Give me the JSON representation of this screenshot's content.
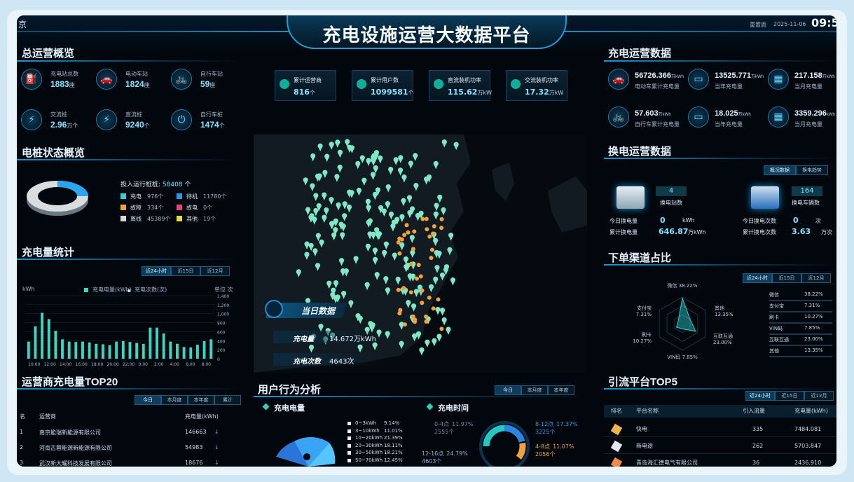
{
  "header": {
    "title": "充电设施运营大数据平台",
    "left_fragment": "京",
    "right_label": "重置面",
    "date": "2025-11-06",
    "clock": "09:5"
  },
  "overview": {
    "title": "总运营概览",
    "items": [
      {
        "label": "充电站总数",
        "value": "1883",
        "unit": "座",
        "icon": "charging-station-icon"
      },
      {
        "label": "电动车站",
        "value": "1824",
        "unit": "座",
        "icon": "electric-car-icon"
      },
      {
        "label": "自行车站",
        "value": "59",
        "unit": "座",
        "icon": "bicycle-icon"
      },
      {
        "label": "交流桩",
        "value": "2.96",
        "unit": "万个",
        "icon": "ac-charger-icon"
      },
      {
        "label": "直流桩",
        "value": "9240",
        "unit": "个",
        "icon": "dc-charger-icon"
      },
      {
        "label": "自行车桩",
        "value": "1474",
        "unit": "个",
        "icon": "bike-charger-icon"
      }
    ]
  },
  "pile_status": {
    "title": "电桩状态概览",
    "running_label": "投入运行桩桩:",
    "running_value": "58408",
    "running_unit": "个",
    "legend": [
      {
        "label": "充电",
        "value": "976个",
        "color": "#2fd3d6"
      },
      {
        "label": "待机",
        "value": "11780个",
        "color": "#1f9cf0"
      },
      {
        "label": "故障",
        "value": "334个",
        "color": "#f2a23b"
      },
      {
        "label": "故电",
        "value": "0个",
        "color": "#e8447a"
      },
      {
        "label": "离线",
        "value": "45389个",
        "color": "#d5d9dc"
      },
      {
        "label": "其他",
        "value": "19个",
        "color": "#e3e043"
      }
    ]
  },
  "charge_stats": {
    "title": "充电量统计",
    "tabs": [
      "近24小时",
      "近15日",
      "近12月"
    ],
    "legend": [
      "充电电量(kWh)",
      "充电次数(次)"
    ],
    "left_unit": "kWh",
    "right_unit": "单位 次",
    "right_ticks": [
      "1,400",
      "1,200",
      "1,000",
      "800",
      "600",
      "400",
      "200",
      "0"
    ]
  },
  "operator_top": {
    "title": "运营商充电量TOP20",
    "tabs": [
      "今日",
      "本月度",
      "本年度",
      "累计"
    ],
    "headers": [
      "名",
      "运营商",
      "充电量(kWh)"
    ],
    "rows": [
      {
        "rank": "1",
        "name": "南京能瑞新能源有限公司",
        "value": "146663"
      },
      {
        "rank": "2",
        "name": "河南古蓉能源新能源有限公司",
        "value": "54983"
      },
      {
        "rank": "3",
        "name": "武汉新大耀科技发展有限公司",
        "value": "18676"
      }
    ]
  },
  "stats_top": [
    {
      "label": "累计运营商",
      "value": "816",
      "unit": "个"
    },
    {
      "label": "累计用户数",
      "value": "1099581",
      "unit": "个"
    },
    {
      "label": "直流装机功率",
      "value": "115.62",
      "unit": "万kW"
    },
    {
      "label": "交流装机功率",
      "value": "17.32",
      "unit": "万kW"
    }
  ],
  "map": {
    "today_label": "当日数据",
    "charge_label": "充电量",
    "charge_value": "14.672万kWh",
    "count_label": "充电次数",
    "count_value": "4643次"
  },
  "user_behavior": {
    "title": "用户行为分析",
    "tabs": [
      "今日",
      "本月度",
      "本年度"
    ],
    "energy_title": "充电电量",
    "time_title": "充电时间",
    "energy_legend": [
      {
        "label": "0~3kWh",
        "value": "9.14%"
      },
      {
        "label": "3~10kWh",
        "value": "11.01%"
      },
      {
        "label": "10~20kWh",
        "value": "21.39%"
      },
      {
        "label": "20~30kWh",
        "value": "18.11%"
      },
      {
        "label": "30~50kWh",
        "value": "18.21%"
      },
      {
        "label": "50~70kWh",
        "value": "12.45%"
      }
    ],
    "time_labels": [
      {
        "label": "0-4点",
        "value": "11.97%",
        "count": "2555个"
      },
      {
        "label": "8-12点",
        "value": "17.37%",
        "count": "3225个"
      },
      {
        "label": "4-8点",
        "value": "11.07%",
        "count": "2056个"
      },
      {
        "label": "12-16点",
        "value": "24.79%",
        "count": "4603个"
      }
    ]
  },
  "ops_data": {
    "title": "充电运营数据",
    "items": [
      {
        "value": "56726.366",
        "unit": "万kWh",
        "label": "电动车累计充电量"
      },
      {
        "value": "13525.771",
        "unit": "万kWh",
        "label": "当年充电量"
      },
      {
        "value": "217.158",
        "unit": "万kWh",
        "label": "当月充电量"
      },
      {
        "value": "57.603",
        "unit": "万kWh",
        "label": "自行车累计充电量"
      },
      {
        "value": "18.025",
        "unit": "万kWh",
        "label": "当年充电量"
      },
      {
        "value": "3359.296",
        "unit": "kWh",
        "label": "当月充电量"
      }
    ]
  },
  "swap": {
    "title": "换电运营数据",
    "tabs": [
      "概况数据",
      "换电趋势"
    ],
    "station_count": "4",
    "station_label": "换电站数",
    "vehicle_count": "164",
    "vehicle_label": "换电车辆数",
    "left_rows": [
      {
        "label": "今日换电量",
        "value": "0",
        "unit": "kWh"
      },
      {
        "label": "累计换电量",
        "value": "646.87",
        "unit": "万kWh"
      }
    ],
    "right_rows": [
      {
        "label": "今日换电次数",
        "value": "0",
        "unit": "次"
      },
      {
        "label": "累计换电次数",
        "value": "3.63",
        "unit": "万次"
      }
    ]
  },
  "channel": {
    "title": "下单渠道占比",
    "tabs": [
      "近24小时",
      "近15日",
      "近12月"
    ],
    "radar": [
      {
        "label": "微信",
        "value": "38.22%"
      },
      {
        "label": "其他",
        "value": "13.35%"
      },
      {
        "label": "互联互通",
        "value": "23.00%"
      },
      {
        "label": "VIN码",
        "value": "7.85%"
      },
      {
        "label": "刷卡",
        "value": "10.27%"
      },
      {
        "label": "支付宝",
        "value": "7.31%"
      }
    ],
    "list": [
      {
        "label": "微信",
        "value": "38.22%"
      },
      {
        "label": "支付宝",
        "value": "7.31%"
      },
      {
        "label": "刷卡",
        "value": "10.27%"
      },
      {
        "label": "VIN码",
        "value": "7.85%"
      },
      {
        "label": "互联互通",
        "value": "23.00%"
      },
      {
        "label": "其他",
        "value": "13.35%"
      }
    ]
  },
  "traffic": {
    "title": "引流平台TOP5",
    "tabs": [
      "近24小时",
      "近15日",
      "近12月"
    ],
    "headers": [
      "排名",
      "平台名称",
      "引入流量",
      "充电量(kWh)"
    ],
    "rows": [
      {
        "name": "快电",
        "flow": "335",
        "energy": "7484.081"
      },
      {
        "name": "新电途",
        "flow": "262",
        "energy": "5703.847"
      },
      {
        "name": "青岛海汇德电气有限公司",
        "flow": "36",
        "energy": "2436.910"
      }
    ]
  },
  "colors": {
    "accent": "#2ad0c8",
    "value": "#7ee3ff",
    "bar": "#3dd6c0"
  },
  "chart_data": {
    "type": "bar",
    "title": "充电量统计",
    "categories": [
      "10:00",
      "12:00",
      "14:00",
      "16:00",
      "18:00",
      "20:00",
      "22:00",
      "0:00",
      "2:00",
      "4:00",
      "6:00",
      "8:00"
    ],
    "series": [
      {
        "name": "充电电量(kWh)",
        "values": [
          380,
          720,
          1020,
          880,
          620,
          430,
          380,
          370,
          380,
          360,
          330,
          320,
          300,
          380,
          390,
          370,
          350,
          330,
          690,
          690,
          560,
          380,
          330,
          260,
          250,
          310,
          390,
          430
        ]
      }
    ],
    "ylim_right": [
      0,
      1400
    ]
  }
}
